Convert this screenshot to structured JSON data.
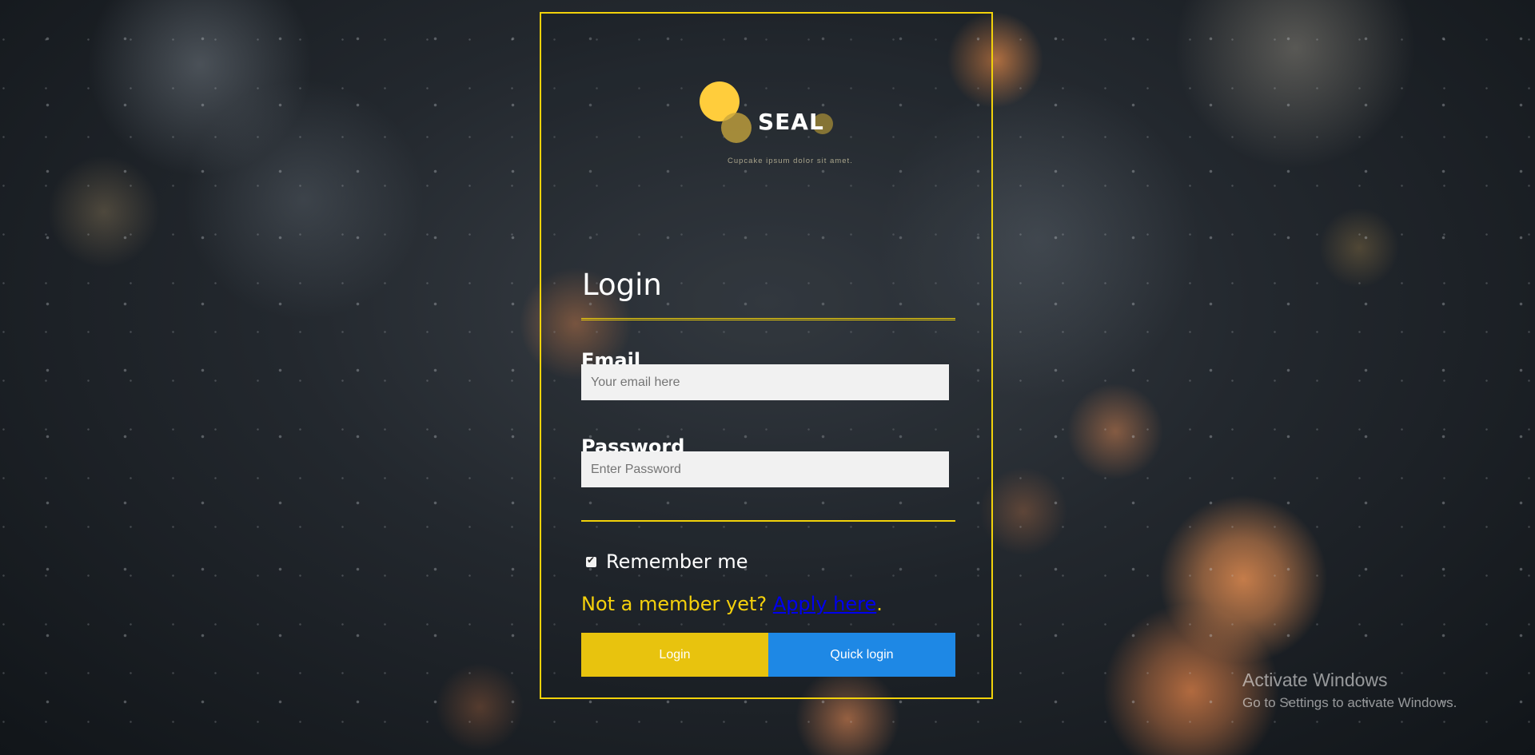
{
  "colors": {
    "accent_yellow": "#f2d20a",
    "login_button": "#e8c30e",
    "quick_login_button": "#1e88e5",
    "link": "#0000ee",
    "input_background": "#f1f1f1"
  },
  "brand": {
    "name": "SEAL",
    "tagline": "Cupcake ipsum dolor sit amet."
  },
  "form": {
    "heading": "Login",
    "email_label": "Email",
    "email_placeholder": "Your email here",
    "email_value": "",
    "password_label": "Password",
    "password_placeholder": "Enter Password",
    "password_value": "",
    "remember_label": "Remember me",
    "remember_checked": true,
    "member_prefix": "Not a member yet? ",
    "apply_link": "Apply here",
    "member_suffix": ".",
    "login_button": "Login",
    "quick_login_button": "Quick login"
  },
  "os_watermark": {
    "title": "Activate Windows",
    "subtitle": "Go to Settings to activate Windows."
  }
}
